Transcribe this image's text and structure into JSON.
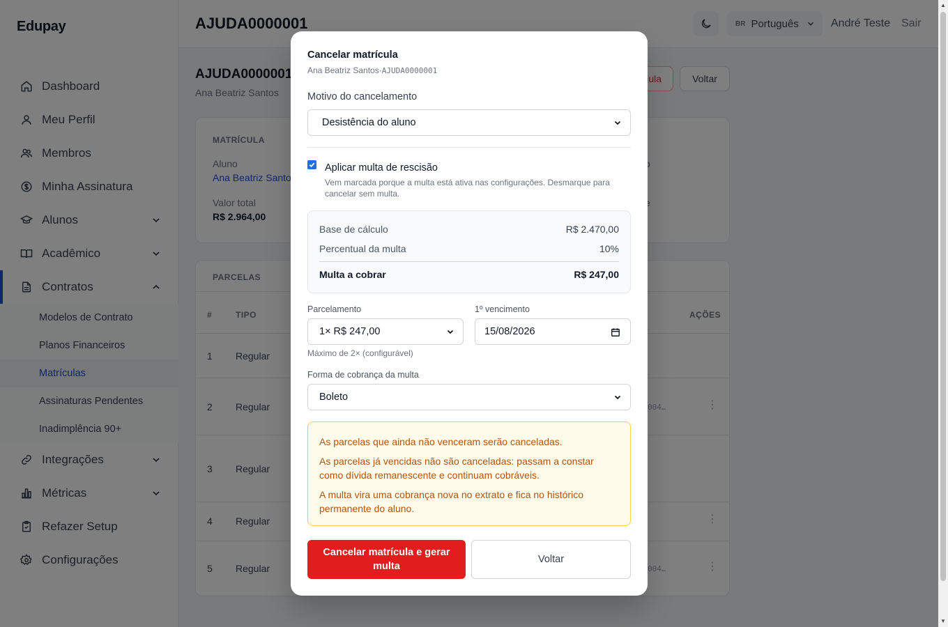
{
  "app": {
    "brand": "Edupay"
  },
  "sidebar": {
    "items": [
      {
        "label": "Dashboard",
        "icon": "home-icon"
      },
      {
        "label": "Meu Perfil",
        "icon": "user-icon"
      },
      {
        "label": "Membros",
        "icon": "users-icon"
      },
      {
        "label": "Minha Assinatura",
        "icon": "dollar-icon"
      },
      {
        "label": "Alunos",
        "icon": "graduation-cap-icon"
      },
      {
        "label": "Acadêmico",
        "icon": "book-icon"
      },
      {
        "label": "Contratos",
        "icon": "file-icon"
      },
      {
        "label": "Integrações",
        "icon": "link-icon"
      },
      {
        "label": "Métricas",
        "icon": "bar-chart-icon"
      },
      {
        "label": "Refazer Setup",
        "icon": "clipboard-icon"
      },
      {
        "label": "Configurações",
        "icon": "gear-icon"
      }
    ],
    "contratos_sub": [
      {
        "label": "Modelos de Contrato"
      },
      {
        "label": "Planos Financeiros"
      },
      {
        "label": "Matrículas"
      },
      {
        "label": "Assinaturas Pendentes"
      },
      {
        "label": "Inadimplência 90+"
      }
    ]
  },
  "header": {
    "title": "AJUDA0000001",
    "language": {
      "flag": "BR",
      "label": "Português"
    },
    "user": "André Teste",
    "logout": "Sair"
  },
  "page": {
    "title": "AJUDA0000001",
    "subtitle": "Ana Beatriz Santos",
    "cancel_btn_partial": "ula",
    "back_btn": "Voltar",
    "matricula_card": {
      "label": "MATRÍCULA",
      "aluno_key": "Aluno",
      "aluno_value": "Ana Beatriz Santo",
      "valor_key": "Valor total",
      "valor_value": "R$ 2.964,00",
      "right_frag_1": "o",
      "right_frag_2": "e"
    },
    "parcelas": {
      "label": "PARCELAS",
      "headers": {
        "num": "#",
        "tipo": "TIPO",
        "acoes": "AÇÕES"
      },
      "rows": [
        {
          "num": "1",
          "tipo": "Regular",
          "code": ""
        },
        {
          "num": "2",
          "tipo": "Regular",
          "code": "004…"
        },
        {
          "num": "3",
          "tipo": "Regular",
          "code": ""
        },
        {
          "num": "4",
          "tipo": "Regular",
          "code": ""
        },
        {
          "num": "5",
          "tipo": "Regular",
          "code": "004…"
        }
      ]
    }
  },
  "modal": {
    "title": "Cancelar matrícula",
    "subtitle_name": "Ana Beatriz Santos",
    "subtitle_sep": "·",
    "subtitle_code": "AJUDA0000001",
    "motivo_label": "Motivo do cancelamento",
    "motivo_value": "Desistência do aluno",
    "multa_checkbox_label": "Aplicar multa de rescisão",
    "multa_checked": true,
    "multa_help": "Vem marcada porque a multa está ativa nas configurações. Desmarque para cancelar sem multa.",
    "calc": {
      "base_label": "Base de cálculo",
      "base_value": "R$ 2.470,00",
      "percent_label": "Percentual da multa",
      "percent_value": "10%",
      "total_label": "Multa a cobrar",
      "total_value": "R$ 247,00"
    },
    "parcelamento_label": "Parcelamento",
    "parcelamento_value": "1× R$ 247,00",
    "parcelamento_hint": "Máximo de 2× (configurável)",
    "vencimento_label": "1º vencimento",
    "vencimento_value": "15/08/2026",
    "forma_label": "Forma de cobrança da multa",
    "forma_value": "Boleto",
    "warnings": [
      "As parcelas que ainda não venceram serão canceladas.",
      "As parcelas já vencidas não são canceladas: passam a constar como dívida remanescente e continuam cobráveis.",
      "A multa vira uma cobrança nova no extrato e fica no histórico permanente do aluno."
    ],
    "confirm_btn": "Cancelar matrícula e gerar multa",
    "back_btn": "Voltar"
  },
  "colors": {
    "accent": "#1d4ed8",
    "danger": "#e11d1d",
    "warning_text": "#b45309",
    "warning_bg": "#fffbeb"
  }
}
